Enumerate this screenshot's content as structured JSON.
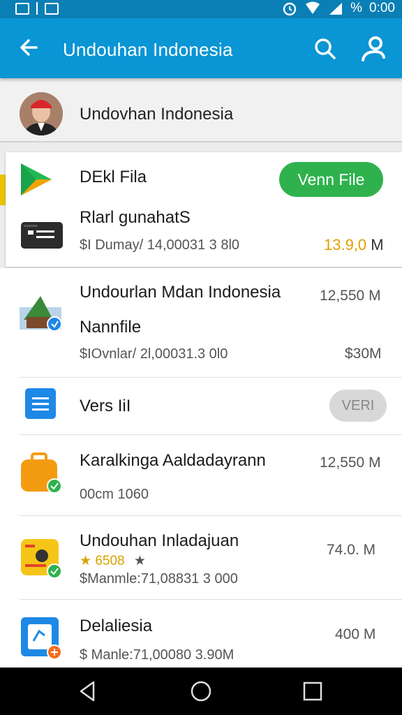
{
  "status_bar": {
    "time": "0:00",
    "battery_label": "%"
  },
  "app_bar": {
    "title": "Undouhan Indonesia"
  },
  "profile": {
    "name": "Undovhan Indonesia"
  },
  "featured": {
    "title": "DEkl Fila",
    "subtitle": "Rlarl gunahatS",
    "meta": "$I Dumay/ 14,00031 3 8l0",
    "size": "13.9,0",
    "size_unit": "M",
    "action_label": "Venn File"
  },
  "items": [
    {
      "title": "Undourlan Mdan Indonesia",
      "subtitle": "Nannfile",
      "meta": "$IOvnlar/ 2l,00031.3 0l0",
      "size": "12,550 M",
      "size2": "$30M"
    },
    {
      "title": "Vers IiI",
      "action_label": "VERI"
    },
    {
      "title": "Karalkinga Aaldadayrann",
      "meta": "00cm 1060",
      "size": "12,550 M"
    },
    {
      "title": "Undouhan Inladajuan",
      "rating": "6508",
      "meta": "$Manmle:71,08831 3 000",
      "size": "74.0. M"
    },
    {
      "title": "Delaliesia",
      "meta": "$ Manle:71,00080 3.90M",
      "size": "400 M"
    }
  ],
  "colors": {
    "primary": "#0a95d4",
    "status": "#0a7fb5",
    "accent_green": "#2fb24d",
    "size_highlight": "#e0a000"
  }
}
